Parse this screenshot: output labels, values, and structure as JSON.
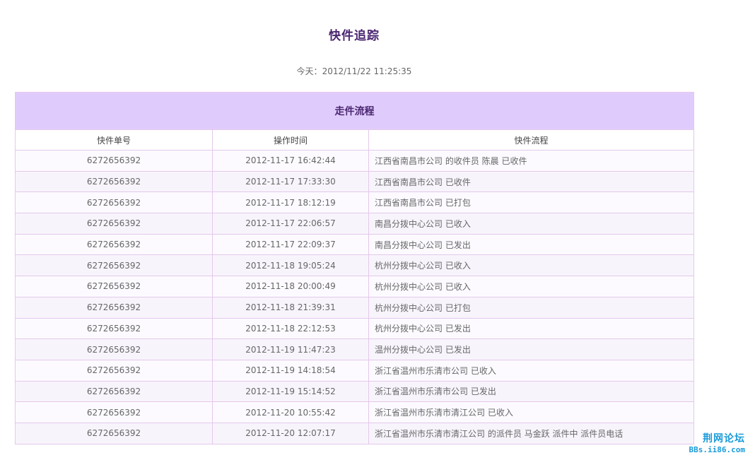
{
  "page": {
    "title": "快件追踪",
    "today_label": "今天：",
    "today_value": "2012/11/22 11:25:35"
  },
  "table": {
    "caption": "走件流程",
    "headers": {
      "number": "快件单号",
      "time": "操作时间",
      "flow": "快件流程"
    },
    "rows": [
      {
        "number": "6272656392",
        "time": "2012-11-17 16:42:44",
        "flow": "江西省南昌市公司 的收件员 陈晨 已收件"
      },
      {
        "number": "6272656392",
        "time": "2012-11-17 17:33:30",
        "flow": "江西省南昌市公司 已收件"
      },
      {
        "number": "6272656392",
        "time": "2012-11-17 18:12:19",
        "flow": "江西省南昌市公司 已打包"
      },
      {
        "number": "6272656392",
        "time": "2012-11-17 22:06:57",
        "flow": "南昌分拨中心公司 已收入"
      },
      {
        "number": "6272656392",
        "time": "2012-11-17 22:09:37",
        "flow": "南昌分拨中心公司 已发出"
      },
      {
        "number": "6272656392",
        "time": "2012-11-18 19:05:24",
        "flow": "杭州分拨中心公司 已收入"
      },
      {
        "number": "6272656392",
        "time": "2012-11-18 20:00:49",
        "flow": "杭州分拨中心公司 已收入"
      },
      {
        "number": "6272656392",
        "time": "2012-11-18 21:39:31",
        "flow": "杭州分拨中心公司 已打包"
      },
      {
        "number": "6272656392",
        "time": "2012-11-18 22:12:53",
        "flow": "杭州分拨中心公司 已发出"
      },
      {
        "number": "6272656392",
        "time": "2012-11-19 11:47:23",
        "flow": "温州分拨中心公司 已发出"
      },
      {
        "number": "6272656392",
        "time": "2012-11-19 14:18:54",
        "flow": "浙江省温州市乐清市公司 已收入"
      },
      {
        "number": "6272656392",
        "time": "2012-11-19 15:14:52",
        "flow": "浙江省温州市乐清市公司 已发出"
      },
      {
        "number": "6272656392",
        "time": "2012-11-20 10:55:42",
        "flow": "浙江省温州市乐清市清江公司 已收入"
      },
      {
        "number": "6272656392",
        "time": "2012-11-20 12:07:17",
        "flow": "浙江省温州市乐清市清江公司 的派件员 马金跃 派件中 派件员电话"
      }
    ]
  },
  "watermark": {
    "cn": "荆网论坛",
    "en": "BBs.ii86.com"
  },
  "colors": {
    "title": "#4a2670",
    "caption_bg": "#e0ccfc",
    "border": "#e3c9ea",
    "watermark": "#1a9bd8"
  }
}
